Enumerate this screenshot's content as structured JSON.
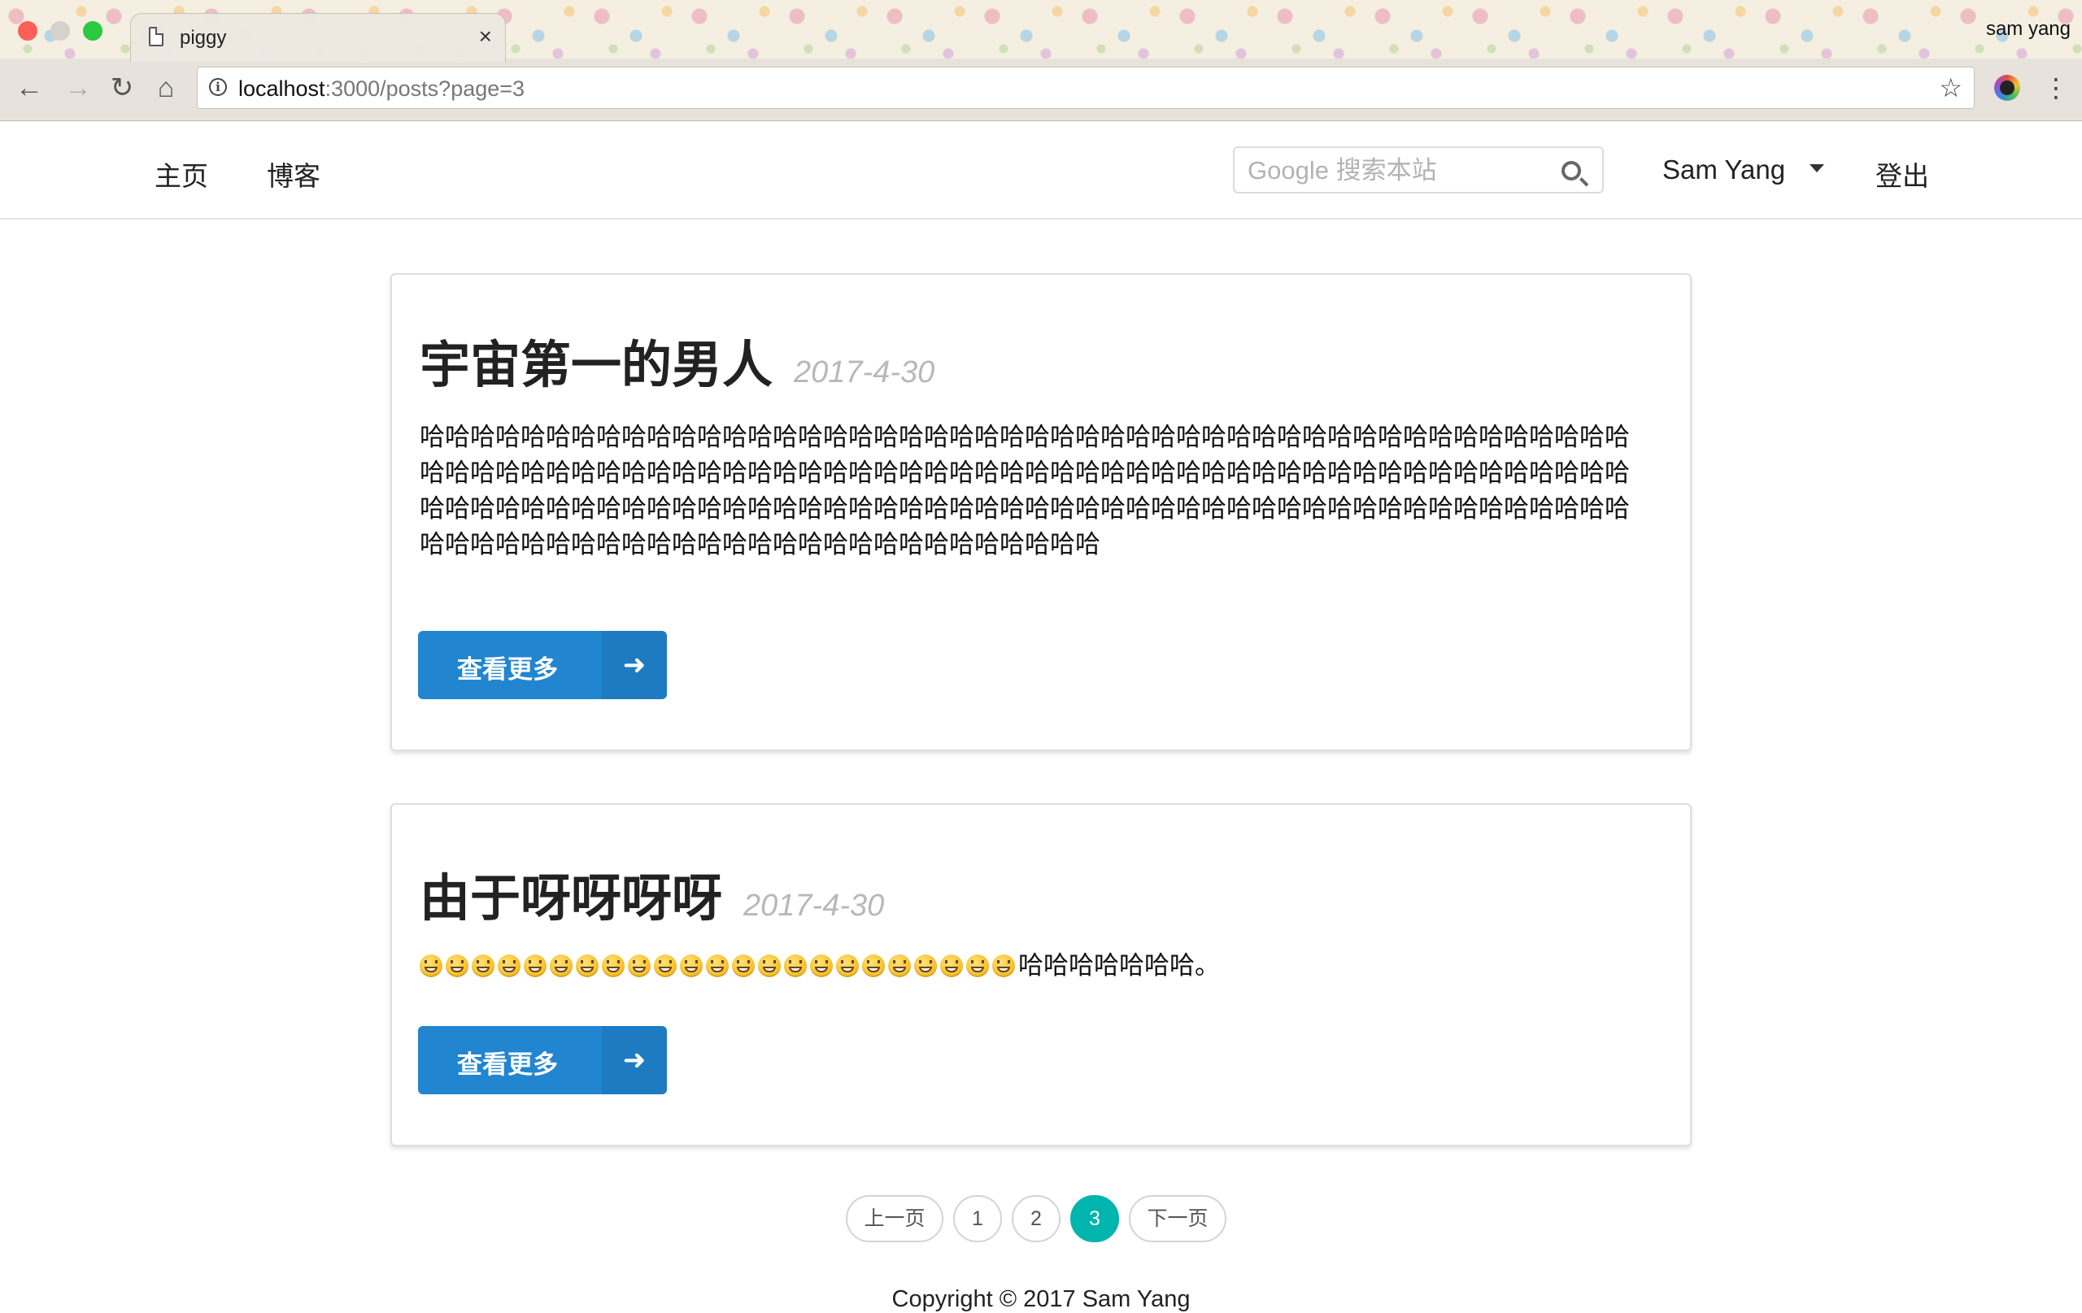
{
  "browser": {
    "tab_title": "piggy",
    "tab_close": "×",
    "profile_name": "sam yang",
    "url_host": "localhost",
    "url_rest": ":3000/posts?page=3"
  },
  "nav": {
    "home": "主页",
    "blog": "博客",
    "search_placeholder": "Google 搜索本站",
    "user_name": "Sam Yang",
    "logout": "登出"
  },
  "posts": [
    {
      "title": "宇宙第一的男人",
      "date": "2017-4-30",
      "excerpt": "哈哈哈哈哈哈哈哈哈哈哈哈哈哈哈哈哈哈哈哈哈哈哈哈哈哈哈哈哈哈哈哈哈哈哈哈哈哈哈哈哈哈哈哈哈哈哈哈哈哈哈哈哈哈哈哈哈哈哈哈哈哈哈哈哈哈哈哈哈哈哈哈哈哈哈哈哈哈哈哈哈哈哈哈哈哈哈哈哈哈哈哈哈哈哈哈哈哈哈哈哈哈哈哈哈哈哈哈哈哈哈哈哈哈哈哈哈哈哈哈哈哈哈哈哈哈哈哈哈哈哈哈哈哈哈哈哈哈哈哈哈哈哈哈哈哈哈哈哈哈哈哈哈哈哈哈哈哈哈哈哈哈哈哈哈哈哈哈哈哈哈",
      "button": "查看更多"
    },
    {
      "title": "由于呀呀呀呀",
      "date": "2017-4-30",
      "emoji_count": 23,
      "excerpt_text": "哈哈哈哈哈哈哈。",
      "button": "查看更多"
    }
  ],
  "pagination": {
    "prev": "上一页",
    "pages": [
      "1",
      "2",
      "3"
    ],
    "current": "3",
    "next": "下一页"
  },
  "footer": "Copyright © 2017 Sam Yang",
  "colors": {
    "button": "#2185d0",
    "active_page": "#00b5ad"
  }
}
